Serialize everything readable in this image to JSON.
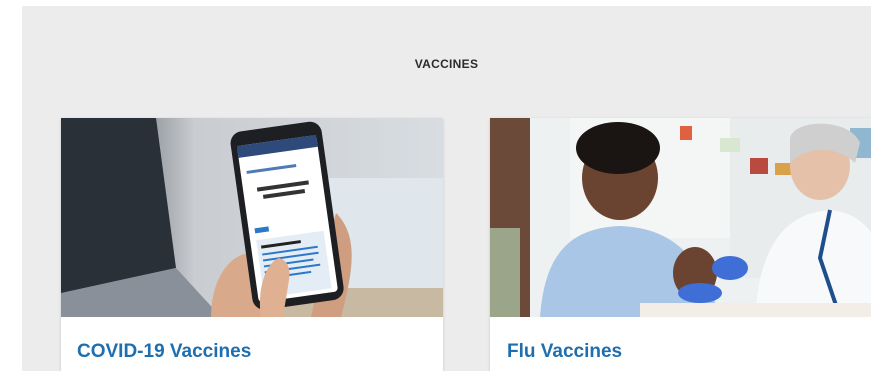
{
  "section": {
    "title": "VACCINES"
  },
  "cards": [
    {
      "title": "COVID-19 Vaccines",
      "image_icon": "phone-vaccine-info-image"
    },
    {
      "title": "Flu Vaccines",
      "image_icon": "pharmacist-vaccination-image"
    }
  ],
  "colors": {
    "section_background": "#ececec",
    "card_title": "#1f6fb0",
    "section_title": "#2b2b2b"
  }
}
